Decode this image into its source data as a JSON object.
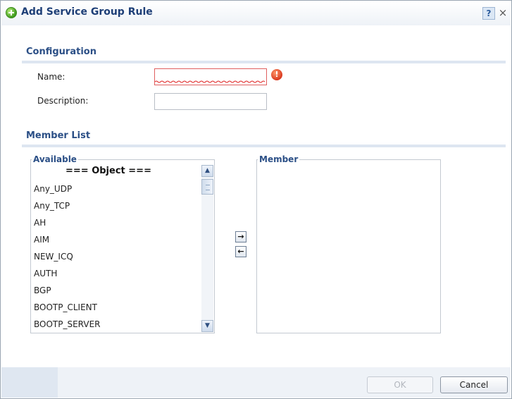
{
  "dialog": {
    "title": "Add Service Group Rule",
    "help_label": "?",
    "close_label": "×"
  },
  "configuration": {
    "title": "Configuration",
    "name_label": "Name:",
    "name_value": "",
    "description_label": "Description:",
    "description_value": "",
    "error_icon": "!"
  },
  "member_list": {
    "title": "Member List",
    "available_label": "Available",
    "member_label": "Member",
    "object_header": "=== Object ===",
    "available_items": [
      "Any_UDP",
      "Any_TCP",
      "AH",
      "AIM",
      "NEW_ICQ",
      "AUTH",
      "BGP",
      "BOOTP_CLIENT",
      "BOOTP_SERVER"
    ],
    "member_items": [],
    "add_arrow": "→",
    "remove_arrow": "←",
    "scroll_up": "▲",
    "scroll_down": "▼"
  },
  "footer": {
    "ok_label": "OK",
    "cancel_label": "Cancel"
  },
  "colors": {
    "accent": "#2b4f86",
    "error": "#d9381e"
  }
}
